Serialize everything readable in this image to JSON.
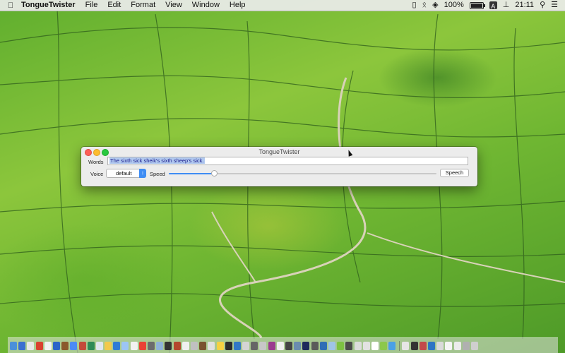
{
  "menubar": {
    "app_name": "TongueTwister",
    "menus": [
      "File",
      "Edit",
      "Format",
      "View",
      "Window",
      "Help"
    ],
    "battery_percent": "100%",
    "input_source": "A",
    "clock": "21:11"
  },
  "window": {
    "title": "TongueTwister",
    "words_label": "Words",
    "words_value": "The sixth sick sheik's sixth sheep's sick.",
    "voice_label": "Voice",
    "voice_selected": "default",
    "speed_label": "Speed",
    "speed_fraction": 0.17,
    "speech_button": "Speech"
  },
  "dock": {
    "icon_colors": [
      "#4a90d9",
      "#3b6fd1",
      "#e8e8e8",
      "#d9412f",
      "#f2f2f2",
      "#2a64c8",
      "#8b5a2b",
      "#4c8bf5",
      "#c44a3a",
      "#2e8b57",
      "#dfe6ef",
      "#f2c94c",
      "#2f7bd6",
      "#9cc5f5",
      "#f2f2f2",
      "#e94235",
      "#6c6c6c",
      "#8fb3d9",
      "#333333",
      "#b4462d",
      "#f0f0f0",
      "#c0c0c0",
      "#7a5230",
      "#e0e0e0",
      "#f5d142",
      "#2b2b2b",
      "#3178c6",
      "#d4d4d4",
      "#666666",
      "#c7c7c7",
      "#9b3b8f",
      "#efefef",
      "#444444",
      "#6a8caf",
      "#1e2b5c",
      "#5a5a5a",
      "#2f6db5",
      "#9fc4e8",
      "#7dc242",
      "#4b4b4b",
      "#dcdcdc",
      "#e2e2e2",
      "#ffffff",
      "#8cc84b",
      "#4aa0e6",
      "#e6e6e6",
      "#333333",
      "#c24a4a",
      "#2d74c4",
      "#dadada",
      "#f5f5f5",
      "#ececec",
      "#b0b0b0",
      "#cfcfcf"
    ]
  }
}
